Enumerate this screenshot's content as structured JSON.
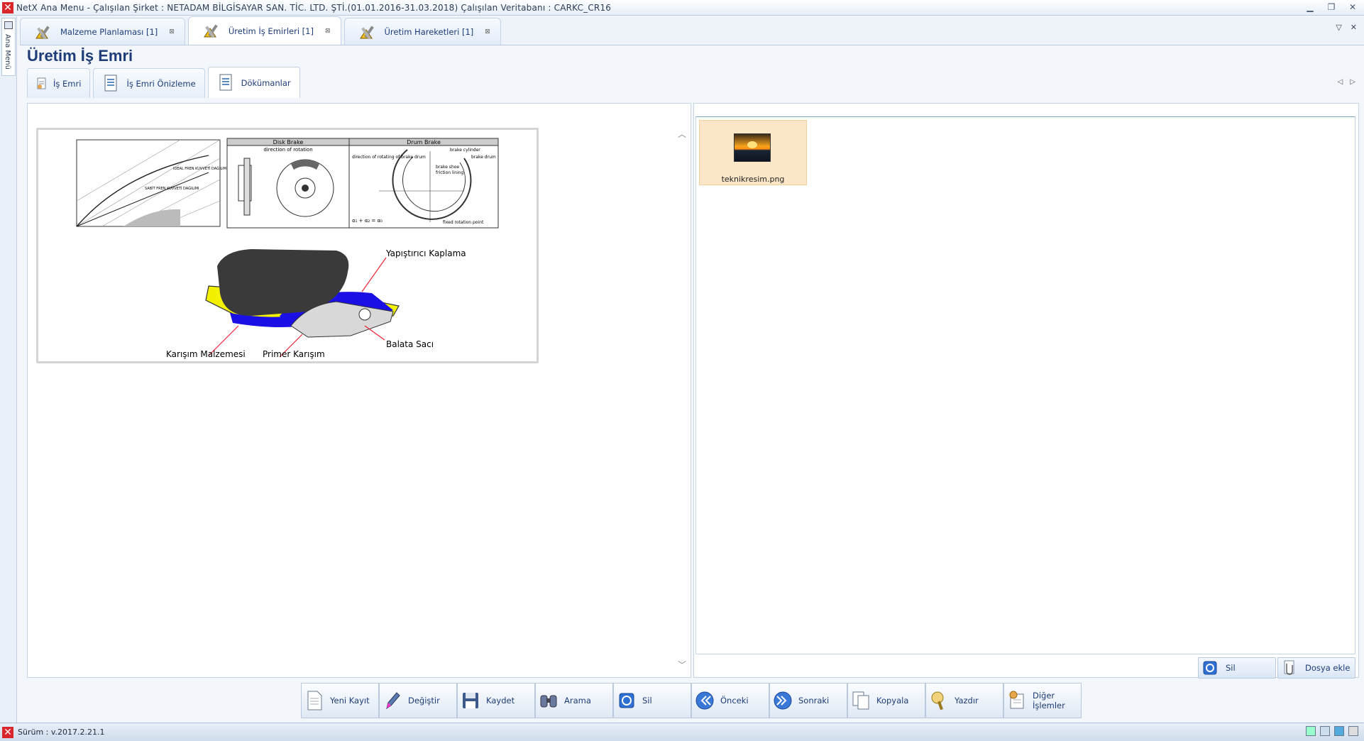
{
  "window": {
    "title": "NetX Ana Menu - Çalışılan Şirket : NETADAM BİLGİSAYAR SAN. TİC. LTD. ŞTİ.(01.01.2016-31.03.2018) Çalışılan Veritabanı : CARKC_CR16",
    "app_icon": "netx-app-icon"
  },
  "left_rail": {
    "label": "Ana Menü"
  },
  "doc_tabs": [
    {
      "label": "Malzeme Planlaması [1]",
      "active": false
    },
    {
      "label": "Üretim İş Emirleri [1]",
      "active": true
    },
    {
      "label": "Üretim Hareketleri [1]",
      "active": false
    }
  ],
  "page_title": "Üretim İş Emri",
  "sub_tabs": [
    {
      "label": "İş Emri",
      "active": false
    },
    {
      "label": "İş Emri Önizleme",
      "active": false
    },
    {
      "label": "Dökümanlar",
      "active": true
    }
  ],
  "preview": {
    "chart_labels": {
      "disk_brake": "Disk Brake",
      "drum_brake": "Drum Brake",
      "direction": "direction of rotation",
      "ideal": "IDEAL FREN KUVVETİ DAĞILIMI",
      "sabit": "SABİT FREN KUVVETİ DAĞILIMI",
      "fixed": "fixed rotation point",
      "brake_cylinder": "brake cylinder",
      "brake_drum": "brake drum",
      "brake_shoe": "brake shoe",
      "friction_lining": "friction lining",
      "drum_direction": "direction of rotating of brake drum",
      "alpha_eq": "α₁ + α₂ = α₀"
    },
    "pad_labels": {
      "adhesive": "Yapıştırıcı Kaplama",
      "plate": "Balata Sacı",
      "primer": "Primer Karışım",
      "mix": "Karışım Malzemesi"
    }
  },
  "files": [
    {
      "name": "teknikresim.png",
      "selected": true
    }
  ],
  "file_buttons": {
    "delete": "Sil",
    "add": "Dosya ekle"
  },
  "toolbar": [
    {
      "key": "new",
      "label": "Yeni Kayıt",
      "icon": "new-record-icon"
    },
    {
      "key": "edit",
      "label": "Değiştir",
      "icon": "edit-pencil-icon"
    },
    {
      "key": "save",
      "label": "Kaydet",
      "icon": "floppy-disk-icon"
    },
    {
      "key": "search",
      "label": "Arama",
      "icon": "binoculars-icon"
    },
    {
      "key": "delete",
      "label": "Sil",
      "icon": "delete-icon"
    },
    {
      "key": "prev",
      "label": "Önceki",
      "icon": "previous-arrow-icon"
    },
    {
      "key": "next",
      "label": "Sonraki",
      "icon": "next-arrow-icon"
    },
    {
      "key": "copy",
      "label": "Kopyala",
      "icon": "copy-icon"
    },
    {
      "key": "print",
      "label": "Yazdır",
      "icon": "printer-icon"
    },
    {
      "key": "other",
      "label": "Diğer İşlemler",
      "icon": "other-operations-icon"
    }
  ],
  "status": {
    "version": "Sürüm : v.2017.2.21.1"
  },
  "colors": {
    "accent": "#1d3c78",
    "selection": "#fbe6c7",
    "app_red": "#d8262b",
    "pad_yellow": "#f2f200",
    "pad_blue": "#1a10e6"
  }
}
